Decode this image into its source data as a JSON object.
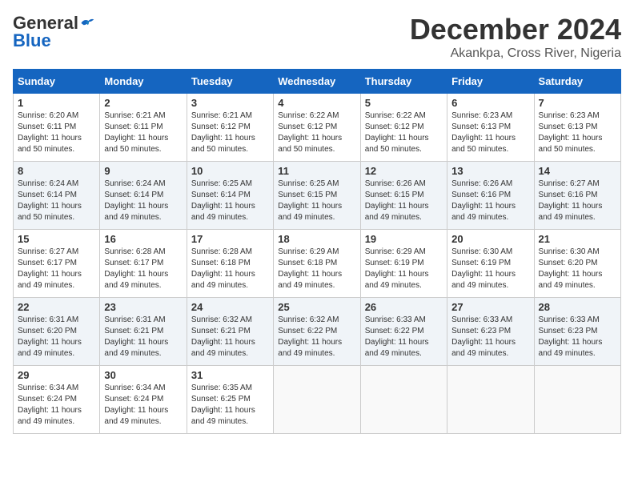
{
  "header": {
    "logo_line1": "General",
    "logo_line2": "Blue",
    "month": "December 2024",
    "location": "Akankpa, Cross River, Nigeria"
  },
  "weekdays": [
    "Sunday",
    "Monday",
    "Tuesday",
    "Wednesday",
    "Thursday",
    "Friday",
    "Saturday"
  ],
  "weeks": [
    [
      {
        "day": "1",
        "sunrise": "6:20 AM",
        "sunset": "6:11 PM",
        "daylight": "11 hours and 50 minutes."
      },
      {
        "day": "2",
        "sunrise": "6:21 AM",
        "sunset": "6:11 PM",
        "daylight": "11 hours and 50 minutes."
      },
      {
        "day": "3",
        "sunrise": "6:21 AM",
        "sunset": "6:12 PM",
        "daylight": "11 hours and 50 minutes."
      },
      {
        "day": "4",
        "sunrise": "6:22 AM",
        "sunset": "6:12 PM",
        "daylight": "11 hours and 50 minutes."
      },
      {
        "day": "5",
        "sunrise": "6:22 AM",
        "sunset": "6:12 PM",
        "daylight": "11 hours and 50 minutes."
      },
      {
        "day": "6",
        "sunrise": "6:23 AM",
        "sunset": "6:13 PM",
        "daylight": "11 hours and 50 minutes."
      },
      {
        "day": "7",
        "sunrise": "6:23 AM",
        "sunset": "6:13 PM",
        "daylight": "11 hours and 50 minutes."
      }
    ],
    [
      {
        "day": "8",
        "sunrise": "6:24 AM",
        "sunset": "6:14 PM",
        "daylight": "11 hours and 50 minutes."
      },
      {
        "day": "9",
        "sunrise": "6:24 AM",
        "sunset": "6:14 PM",
        "daylight": "11 hours and 49 minutes."
      },
      {
        "day": "10",
        "sunrise": "6:25 AM",
        "sunset": "6:14 PM",
        "daylight": "11 hours and 49 minutes."
      },
      {
        "day": "11",
        "sunrise": "6:25 AM",
        "sunset": "6:15 PM",
        "daylight": "11 hours and 49 minutes."
      },
      {
        "day": "12",
        "sunrise": "6:26 AM",
        "sunset": "6:15 PM",
        "daylight": "11 hours and 49 minutes."
      },
      {
        "day": "13",
        "sunrise": "6:26 AM",
        "sunset": "6:16 PM",
        "daylight": "11 hours and 49 minutes."
      },
      {
        "day": "14",
        "sunrise": "6:27 AM",
        "sunset": "6:16 PM",
        "daylight": "11 hours and 49 minutes."
      }
    ],
    [
      {
        "day": "15",
        "sunrise": "6:27 AM",
        "sunset": "6:17 PM",
        "daylight": "11 hours and 49 minutes."
      },
      {
        "day": "16",
        "sunrise": "6:28 AM",
        "sunset": "6:17 PM",
        "daylight": "11 hours and 49 minutes."
      },
      {
        "day": "17",
        "sunrise": "6:28 AM",
        "sunset": "6:18 PM",
        "daylight": "11 hours and 49 minutes."
      },
      {
        "day": "18",
        "sunrise": "6:29 AM",
        "sunset": "6:18 PM",
        "daylight": "11 hours and 49 minutes."
      },
      {
        "day": "19",
        "sunrise": "6:29 AM",
        "sunset": "6:19 PM",
        "daylight": "11 hours and 49 minutes."
      },
      {
        "day": "20",
        "sunrise": "6:30 AM",
        "sunset": "6:19 PM",
        "daylight": "11 hours and 49 minutes."
      },
      {
        "day": "21",
        "sunrise": "6:30 AM",
        "sunset": "6:20 PM",
        "daylight": "11 hours and 49 minutes."
      }
    ],
    [
      {
        "day": "22",
        "sunrise": "6:31 AM",
        "sunset": "6:20 PM",
        "daylight": "11 hours and 49 minutes."
      },
      {
        "day": "23",
        "sunrise": "6:31 AM",
        "sunset": "6:21 PM",
        "daylight": "11 hours and 49 minutes."
      },
      {
        "day": "24",
        "sunrise": "6:32 AM",
        "sunset": "6:21 PM",
        "daylight": "11 hours and 49 minutes."
      },
      {
        "day": "25",
        "sunrise": "6:32 AM",
        "sunset": "6:22 PM",
        "daylight": "11 hours and 49 minutes."
      },
      {
        "day": "26",
        "sunrise": "6:33 AM",
        "sunset": "6:22 PM",
        "daylight": "11 hours and 49 minutes."
      },
      {
        "day": "27",
        "sunrise": "6:33 AM",
        "sunset": "6:23 PM",
        "daylight": "11 hours and 49 minutes."
      },
      {
        "day": "28",
        "sunrise": "6:33 AM",
        "sunset": "6:23 PM",
        "daylight": "11 hours and 49 minutes."
      }
    ],
    [
      {
        "day": "29",
        "sunrise": "6:34 AM",
        "sunset": "6:24 PM",
        "daylight": "11 hours and 49 minutes."
      },
      {
        "day": "30",
        "sunrise": "6:34 AM",
        "sunset": "6:24 PM",
        "daylight": "11 hours and 49 minutes."
      },
      {
        "day": "31",
        "sunrise": "6:35 AM",
        "sunset": "6:25 PM",
        "daylight": "11 hours and 49 minutes."
      },
      null,
      null,
      null,
      null
    ]
  ]
}
